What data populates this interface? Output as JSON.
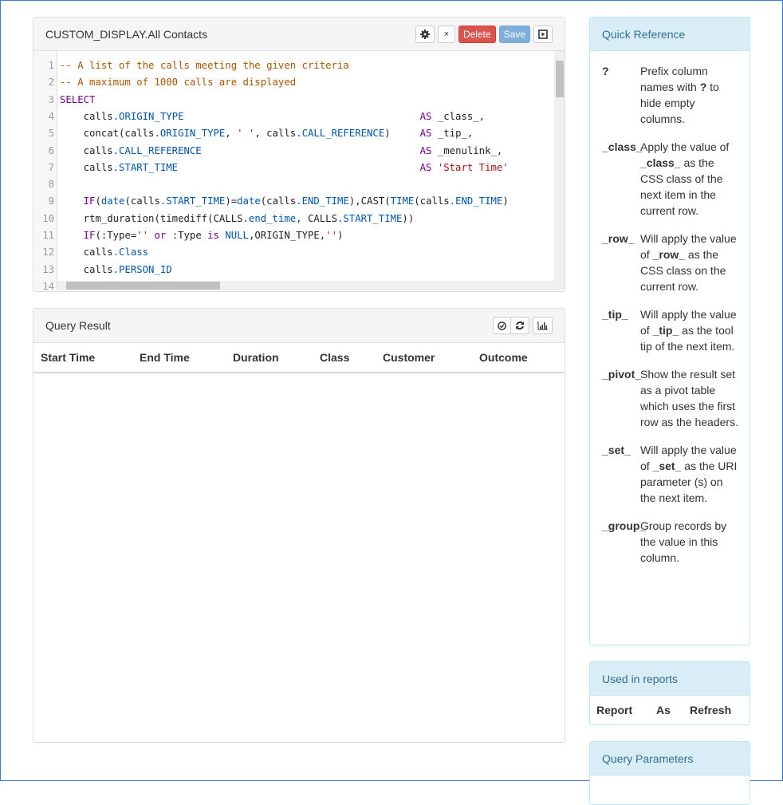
{
  "editor_panel": {
    "title": "CUSTOM_DISPLAY.All Contacts",
    "settings_icon": "gear-icon",
    "close_label": "×",
    "delete_label": "Delete",
    "save_label": "Save",
    "run_icon": "play-icon"
  },
  "code_lines": [
    [
      [
        "-- A list of the calls meeting the given criteria",
        "c"
      ]
    ],
    [
      [
        "-- A maximum of 1000 calls are displayed",
        "c"
      ]
    ],
    [
      [
        "SELECT",
        "k"
      ]
    ],
    [
      [
        "    calls",
        ""
      ],
      [
        ".ORIGIN_TYPE",
        "f"
      ],
      [
        "                                        ",
        ""
      ],
      [
        "AS",
        "k"
      ],
      [
        " _class_,",
        ""
      ]
    ],
    [
      [
        "    concat(calls",
        ""
      ],
      [
        ".ORIGIN_TYPE",
        "f"
      ],
      [
        ", ",
        ""
      ],
      [
        "' '",
        "s"
      ],
      [
        ", calls",
        ""
      ],
      [
        ".CALL_REFERENCE",
        "f"
      ],
      [
        ")     ",
        ""
      ],
      [
        "AS",
        "k"
      ],
      [
        " _tip_,",
        ""
      ]
    ],
    [
      [
        "    calls",
        ""
      ],
      [
        ".CALL_REFERENCE",
        "f"
      ],
      [
        "                                     ",
        ""
      ],
      [
        "AS",
        "k"
      ],
      [
        " _menulink_,",
        ""
      ]
    ],
    [
      [
        "    calls",
        ""
      ],
      [
        ".START_TIME",
        "f"
      ],
      [
        "                                         ",
        ""
      ],
      [
        "AS",
        "k"
      ],
      [
        " ",
        ""
      ],
      [
        "'Start Time'",
        "s"
      ]
    ],
    [
      [
        "",
        ""
      ]
    ],
    [
      [
        "    ",
        ""
      ],
      [
        "IF",
        "k"
      ],
      [
        "(",
        ""
      ],
      [
        "date",
        "f"
      ],
      [
        "(calls",
        ""
      ],
      [
        ".START_TIME",
        "f"
      ],
      [
        ")=",
        ""
      ],
      [
        "date",
        "f"
      ],
      [
        "(calls",
        ""
      ],
      [
        ".END_TIME",
        "f"
      ],
      [
        "),CAST(",
        ""
      ],
      [
        "TIME",
        "f"
      ],
      [
        "(calls",
        ""
      ],
      [
        ".END_TIME",
        "f"
      ],
      [
        ")",
        ""
      ]
    ],
    [
      [
        "    rtm_duration(timediff(CALLS",
        ""
      ],
      [
        ".end_time",
        "f"
      ],
      [
        ", CALLS",
        ""
      ],
      [
        ".START_TIME",
        "f"
      ],
      [
        "))",
        ""
      ]
    ],
    [
      [
        "    ",
        ""
      ],
      [
        "IF",
        "k"
      ],
      [
        "(:Type=",
        ""
      ],
      [
        "''",
        "s"
      ],
      [
        " ",
        ""
      ],
      [
        "or",
        "k"
      ],
      [
        " :Type ",
        ""
      ],
      [
        "is",
        "k"
      ],
      [
        " ",
        ""
      ],
      [
        "NULL",
        "f"
      ],
      [
        ",ORIGIN_TYPE,",
        ""
      ],
      [
        "''",
        "s"
      ],
      [
        ")",
        ""
      ]
    ],
    [
      [
        "    calls",
        ""
      ],
      [
        ".Class",
        "f"
      ]
    ],
    [
      [
        "    calls",
        ""
      ],
      [
        ".PERSON_ID",
        "f"
      ]
    ],
    [
      [
        "    calls",
        ""
      ]
    ]
  ],
  "result_panel": {
    "title": "Query Result",
    "icons": [
      "check-circle-icon",
      "refresh-icon",
      "bar-chart-icon"
    ],
    "columns": [
      "Start Time",
      "End Time",
      "Duration",
      "Class",
      "Customer",
      "Outcome"
    ]
  },
  "quick_reference": {
    "title": "Quick Reference",
    "items": [
      {
        "key": "?",
        "desc_parts": [
          "Prefix column names with ",
          "?",
          " to hide empty columns."
        ]
      },
      {
        "key": "_class_",
        "desc_parts": [
          "Apply the value of ",
          "_class_",
          " as the CSS class of the next item in the current row."
        ]
      },
      {
        "key": "_row_",
        "desc_parts": [
          "Will apply the value of ",
          "_row_",
          " as the CSS class on the current row."
        ]
      },
      {
        "key": "_tip_",
        "desc_parts": [
          "Will apply the value of ",
          "_tip_",
          " as the tool tip of the next item."
        ]
      },
      {
        "key": "_pivot_",
        "desc_parts": [
          "Show the result set as a pivot table which uses the first row as the headers.",
          "",
          ""
        ]
      },
      {
        "key": "_set_",
        "desc_parts": [
          "Will apply the value of ",
          "_set_",
          " as the URI parameter (s) on the next item."
        ]
      },
      {
        "key": "_group_",
        "desc_parts": [
          "Group records by the value in this column.",
          "",
          ""
        ]
      }
    ]
  },
  "used_in_reports": {
    "title": "Used in reports",
    "columns": [
      "Report",
      "As",
      "Refresh"
    ]
  },
  "query_parameters": {
    "title": "Query Parameters"
  }
}
